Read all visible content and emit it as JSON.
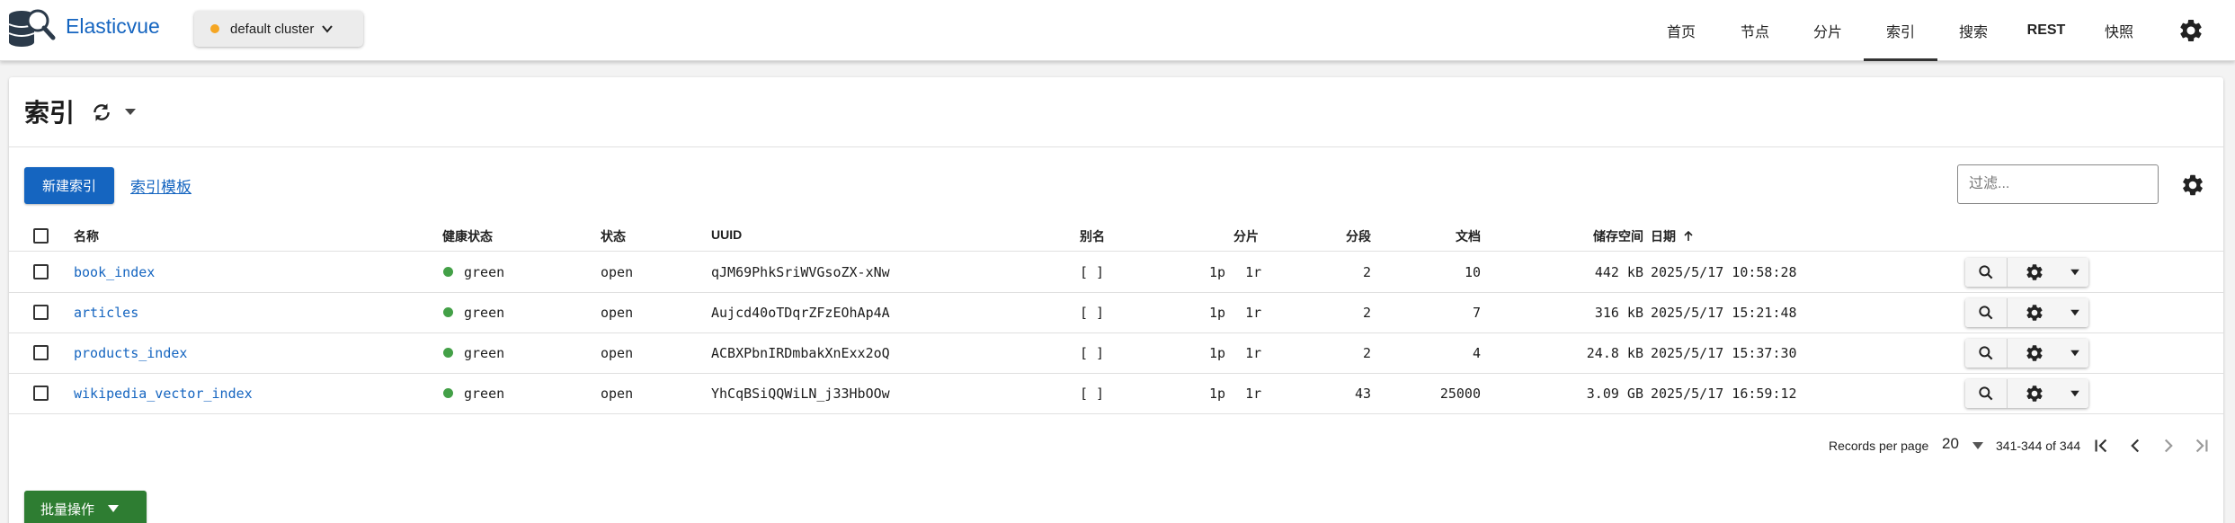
{
  "app": {
    "brand": "Elasticvue",
    "logo_icon": "database-search-logo",
    "cluster": {
      "label": "default cluster",
      "status_color": "#f5a623"
    }
  },
  "nav": {
    "items": [
      {
        "label": "首页",
        "active": false
      },
      {
        "label": "节点",
        "active": false
      },
      {
        "label": "分片",
        "active": false
      },
      {
        "label": "索引",
        "active": true
      },
      {
        "label": "搜索",
        "active": false
      },
      {
        "label": "REST",
        "active": false
      },
      {
        "label": "快照",
        "active": false
      }
    ],
    "settings_icon": "gear-icon"
  },
  "page": {
    "title": "索引",
    "new_index_label": "新建索引",
    "templates_link": "索引模板",
    "filter_placeholder": "过滤...",
    "bulk_label": "批量操作"
  },
  "table": {
    "headers": {
      "name": "名称",
      "health": "健康状态",
      "status": "状态",
      "uuid": "UUID",
      "aliases": "别名",
      "shards": "分片",
      "segments": "分段",
      "docs": "文档",
      "storage": "储存空间",
      "date": "日期"
    },
    "sort": {
      "column": "date",
      "direction": "ascending"
    },
    "rows": [
      {
        "name": "book_index",
        "health": "green",
        "status": "open",
        "uuid": "qJM69PhkSriWVGsoZX-xNw",
        "aliases": "[ ]",
        "primary": "1p",
        "replica": "1r",
        "segments": "2",
        "docs": "10",
        "storage": "442 kB",
        "date": "2025/5/17 10:58:28"
      },
      {
        "name": "articles",
        "health": "green",
        "status": "open",
        "uuid": "Aujcd40oTDqrZFzEOhAp4A",
        "aliases": "[ ]",
        "primary": "1p",
        "replica": "1r",
        "segments": "2",
        "docs": "7",
        "storage": "316 kB",
        "date": "2025/5/17 15:21:48"
      },
      {
        "name": "products_index",
        "health": "green",
        "status": "open",
        "uuid": "ACBXPbnIRDmbakXnExx2oQ",
        "aliases": "[ ]",
        "primary": "1p",
        "replica": "1r",
        "segments": "2",
        "docs": "4",
        "storage": "24.8 kB",
        "date": "2025/5/17 15:37:30"
      },
      {
        "name": "wikipedia_vector_index",
        "health": "green",
        "status": "open",
        "uuid": "YhCqBSiQQWiLN_j33HbOOw",
        "aliases": "[ ]",
        "primary": "1p",
        "replica": "1r",
        "segments": "43",
        "docs": "25000",
        "storage": "3.09 GB",
        "date": "2025/5/17 16:59:12"
      }
    ],
    "health_color": "#43a047"
  },
  "pagination": {
    "records_label": "Records per page",
    "per_page": "20",
    "range": "341-344 of 344"
  }
}
